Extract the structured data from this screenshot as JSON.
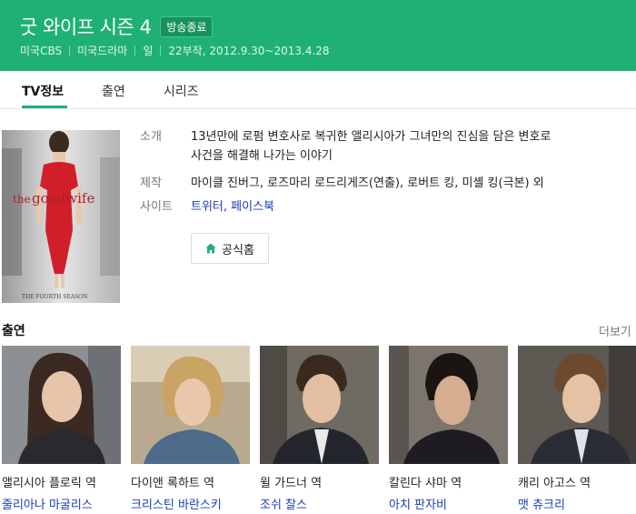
{
  "header": {
    "title": "굿 와이프 시즌 4",
    "badge": "방송종료",
    "meta": [
      "미국CBS",
      "미국드라마",
      "일",
      "22부작, 2012.9.30~2013.4.28"
    ],
    "bg_color": "#1fb174"
  },
  "tabs": [
    {
      "label": "TV정보",
      "active": true
    },
    {
      "label": "출연",
      "active": false
    },
    {
      "label": "시리즈",
      "active": false
    }
  ],
  "poster": {
    "logo_prefix": "the",
    "logo_main": "goodwife",
    "caption": "THE FOURTH SEASON"
  },
  "info": {
    "intro_label": "소개",
    "intro_line1": "13년만에 로펌 변호사로 복귀한 앨리시아가 그녀만의 진심을 담은 변호로",
    "intro_line2": "사건을 해결해 나가는 이야기",
    "production_label": "제작",
    "production_value": "마이클 진버그, 로즈마리 로드리게즈(연출), 로버트 킹, 미셸 킹(극본) 외",
    "site_label": "사이트",
    "site_links": [
      "트위터",
      "페이스북"
    ],
    "site_separator": ",",
    "home_button": "공식홈"
  },
  "cast_section": {
    "title": "출연",
    "more": "더보기",
    "items": [
      {
        "role": "앨리시아 플로릭 역",
        "actor": "줄리아나 마굴리스"
      },
      {
        "role": "다이앤 록하트 역",
        "actor": "크리스틴 바란스키"
      },
      {
        "role": "윌 가드너 역",
        "actor": "조쉬 찰스"
      },
      {
        "role": "칼린다 샤마 역",
        "actor": "아치 판자비"
      },
      {
        "role": "캐리 아고스 역",
        "actor": "맷 츄크리"
      }
    ]
  }
}
